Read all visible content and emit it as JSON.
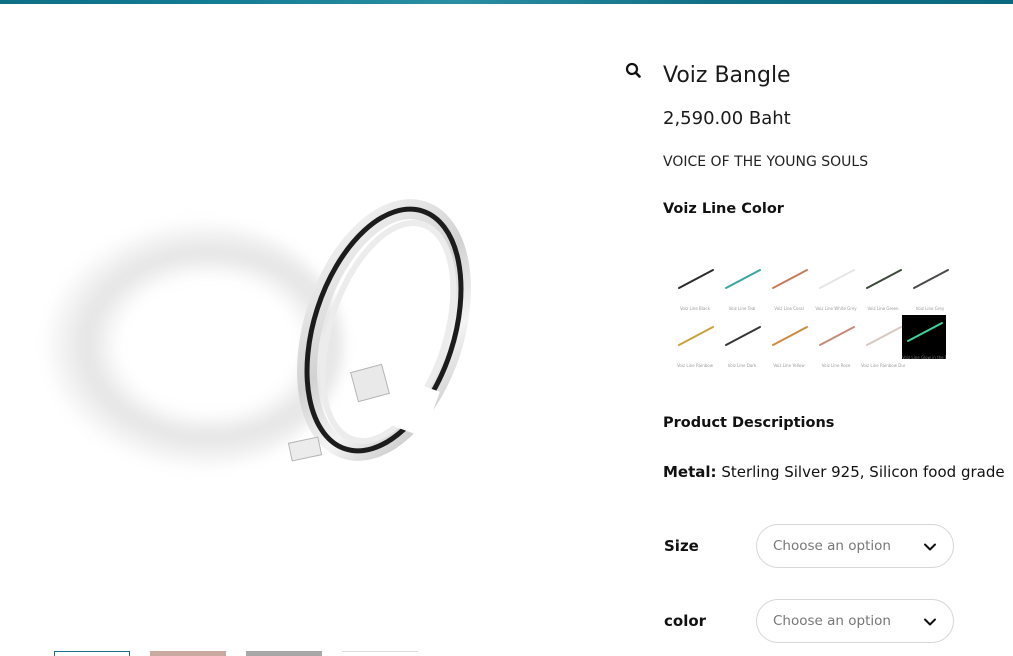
{
  "product": {
    "title": "Voiz Bangle",
    "price": "2,590.00 Baht",
    "tagline": "VOICE OF THE YOUNG SOULS"
  },
  "color_section": {
    "heading": "Voiz Line Color",
    "swatches": [
      {
        "line_color": "#2b2b2b",
        "label": "Voiz Line Black"
      },
      {
        "line_color": "#3aa6a0",
        "label": "Voiz Line Teal"
      },
      {
        "line_color": "#c77b5a",
        "label": "Voiz Line Coral"
      },
      {
        "line_color": "#e6e6e6",
        "label": "Voiz Line White Grey"
      },
      {
        "line_color": "#3c4a3a",
        "label": "Voiz Line Green"
      },
      {
        "line_color": "#4a4a4a",
        "label": "Voiz Line Grey"
      },
      {
        "line_color": "#c9a33a",
        "label": "Voiz Line Rainbow"
      },
      {
        "line_color": "#353535",
        "label": "Voiz Line Dark"
      },
      {
        "line_color": "#d08a40",
        "label": "Voiz Line Yellow"
      },
      {
        "line_color": "#c98a78",
        "label": "Voiz Line Rose"
      },
      {
        "line_color": "#d8c8c0",
        "label": "Voiz Line Rainbow Dust"
      },
      {
        "line_color": "#3fd39a",
        "label": "Voiz Line Glow in the Dark",
        "selected": true
      }
    ]
  },
  "description": {
    "heading": "Product Descriptions",
    "metal_label": "Metal:",
    "metal_value": " Sterling Silver 925, Silicon food grade"
  },
  "options": {
    "size_label": "Size",
    "size_placeholder": "Choose an option",
    "color_label": "color",
    "color_placeholder": "Choose an option"
  },
  "thumbnails": [
    {
      "color": "#ffffff",
      "border": "#1a6f8a",
      "active": true
    },
    {
      "color": "#c9a9a0"
    },
    {
      "color": "#a8a8a8"
    },
    {
      "color": "#ededed"
    }
  ],
  "colors": {
    "accent": "#0d6f86",
    "text": "#111111"
  },
  "icons": {
    "zoom": "magnifier-icon",
    "dropdown": "chevron-down-icon"
  }
}
